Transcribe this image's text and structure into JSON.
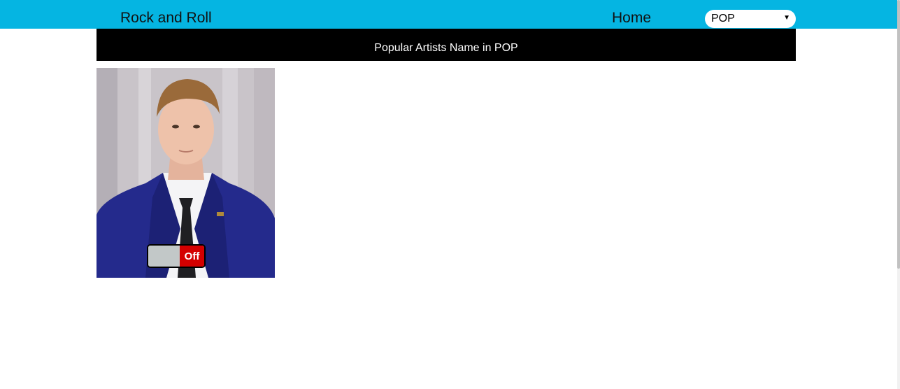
{
  "navbar": {
    "brand": "Rock and Roll",
    "home_link": "Home",
    "genre_select": {
      "selected": "POP"
    },
    "color": "#05b5e2"
  },
  "banner": {
    "title": "Popular Artists Name in POP"
  },
  "artist_card": {
    "photo_icon": "artist-photo",
    "toggle": {
      "state_label": "Off",
      "on": false,
      "state_color": "#d40000"
    }
  }
}
